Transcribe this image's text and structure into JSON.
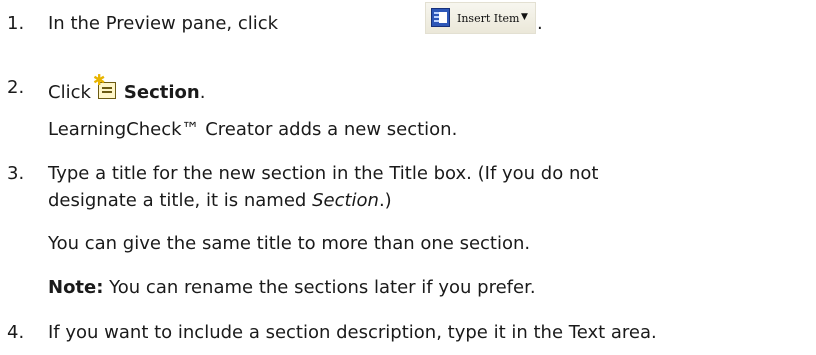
{
  "steps": [
    {
      "number": "1.",
      "text": "In the Preview pane, click",
      "button": {
        "label": "Insert Item",
        "icon": "insert-item-icon",
        "dropdown_icon": "dropdown-arrow-icon"
      },
      "trailing": "."
    },
    {
      "number": "2.",
      "text": "Click",
      "icon": "section-icon",
      "bold": "Section",
      "trailing": ".",
      "result": "LearningCheck™ Creator adds a new section."
    },
    {
      "number": "3.",
      "line1": "Type a title for the new section in the Title box. (If you do not",
      "line2_prefix": "designate a title, it is named ",
      "line2_italic": "Section",
      "line2_suffix": ".)",
      "para": "You can give the same title to more than one section.",
      "note_label": "Note:",
      "note_text": " You can rename the sections later if you prefer."
    },
    {
      "number": "4.",
      "text": "If you want to include a section description, type it in the Text area."
    }
  ]
}
